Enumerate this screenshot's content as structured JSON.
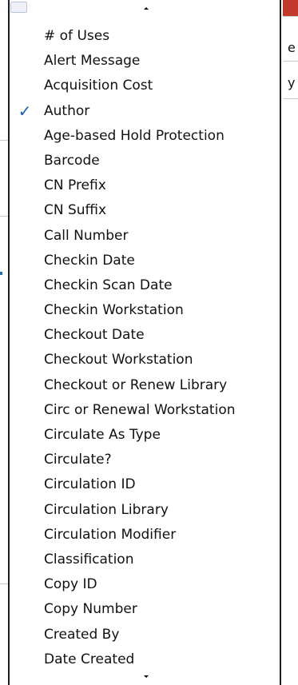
{
  "menu": {
    "items": [
      {
        "label": "# of Uses",
        "checked": false
      },
      {
        "label": "Alert Message",
        "checked": false
      },
      {
        "label": "Acquisition Cost",
        "checked": false
      },
      {
        "label": "Author",
        "checked": true
      },
      {
        "label": "Age-based Hold Protection",
        "checked": false
      },
      {
        "label": "Barcode",
        "checked": false
      },
      {
        "label": "CN Prefix",
        "checked": false
      },
      {
        "label": "CN Suffix",
        "checked": false
      },
      {
        "label": "Call Number",
        "checked": false
      },
      {
        "label": "Checkin Date",
        "checked": false
      },
      {
        "label": "Checkin Scan Date",
        "checked": false
      },
      {
        "label": "Checkin Workstation",
        "checked": false
      },
      {
        "label": "Checkout Date",
        "checked": false
      },
      {
        "label": "Checkout Workstation",
        "checked": false
      },
      {
        "label": "Checkout or Renew Library",
        "checked": false
      },
      {
        "label": "Circ or Renewal Workstation",
        "checked": false
      },
      {
        "label": "Circulate As Type",
        "checked": false
      },
      {
        "label": "Circulate?",
        "checked": false
      },
      {
        "label": "Circulation ID",
        "checked": false
      },
      {
        "label": "Circulation Library",
        "checked": false
      },
      {
        "label": "Circulation Modifier",
        "checked": false
      },
      {
        "label": "Classification",
        "checked": false
      },
      {
        "label": "Copy ID",
        "checked": false
      },
      {
        "label": "Copy Number",
        "checked": false
      },
      {
        "label": "Created By",
        "checked": false
      },
      {
        "label": "Date Created",
        "checked": false
      }
    ],
    "check_glyph": "✓",
    "scroll_up_icon": "triangle-up",
    "scroll_down_icon": "triangle-down",
    "check_color": "#1b5fb4"
  },
  "background": {
    "right_fragments": [
      "e",
      "y"
    ]
  }
}
